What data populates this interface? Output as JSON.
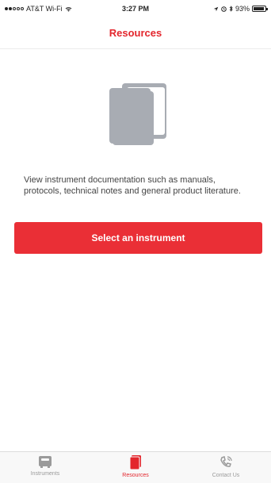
{
  "status_bar": {
    "carrier": "AT&T Wi-Fi",
    "time": "3:27 PM",
    "battery": "93%",
    "battery_level": 0.93
  },
  "nav": {
    "title": "Resources"
  },
  "icons": {
    "main": "documents-icon",
    "tab_instruments": "instrument-icon",
    "tab_resources": "book-icon",
    "tab_contact": "phone-icon"
  },
  "main": {
    "description": "View instrument documentation such as manuals, protocols, technical notes and general product literature.",
    "button_label": "Select an instrument"
  },
  "tabs": [
    {
      "label": "Instruments",
      "active": false
    },
    {
      "label": "Resources",
      "active": true
    },
    {
      "label": "Contact Us",
      "active": false
    }
  ],
  "colors": {
    "accent": "#e3262d",
    "button": "#ea2f36",
    "icon_gray": "#a8acb3",
    "inactive": "#9a9a9a"
  }
}
